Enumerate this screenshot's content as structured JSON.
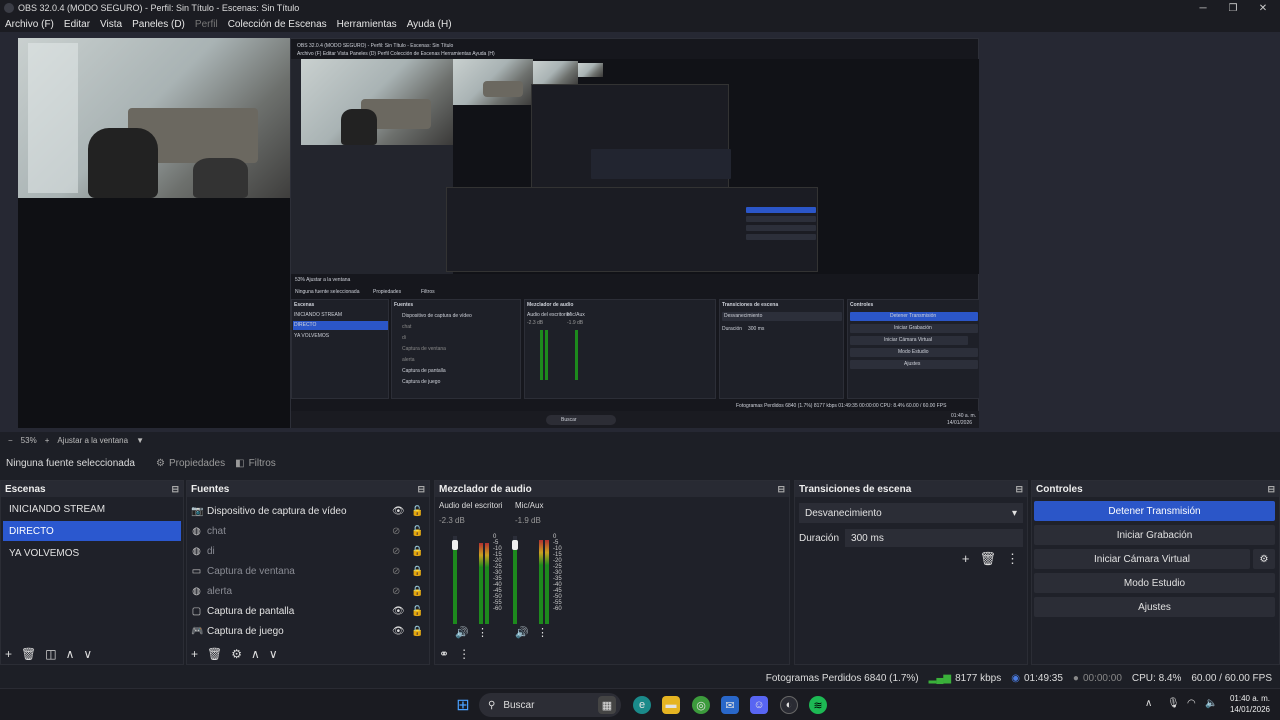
{
  "window": {
    "title": "OBS 32.0.4 (MODO SEGURO) - Perfil: Sin Título - Escenas: Sin Título",
    "minimize": "─",
    "maximize": "❐",
    "close": "✕"
  },
  "menu": [
    "Archivo (F)",
    "Editar",
    "Vista",
    "Paneles (D)",
    "Perfil",
    "Colección de Escenas",
    "Herramientas",
    "Ayuda (H)"
  ],
  "nested_preview": {
    "title": "OBS 32.0.4 (MODO SEGURO) - Perfil: Sin Título - Escenas: Sin Título",
    "menu": "Archivo (F)   Editar   Vista   Paneles (D)   Perfil   Colección de Escenas   Herramientas   Ayuda (H)",
    "zoom": "53%   Ajustar a la ventana",
    "no_source": "Ninguna fuente seleccionada",
    "props": "Propiedades",
    "filters": "Filtros",
    "docks": {
      "scenes": "Escenas",
      "sources": "Fuentes",
      "mixer": "Mezclador de audio",
      "transitions": "Transiciones de escena",
      "controls": "Controles"
    },
    "scenes": [
      "INICIANDO STREAM",
      "DIRECTO",
      "YA VOLVEMOS"
    ],
    "sources": [
      "Dispositivo de captura de vídeo",
      "chat",
      "di",
      "Captura de ventana",
      "alerta",
      "Captura de pantalla",
      "Captura de juego"
    ],
    "mixer_ch1": "Audio del escritorio",
    "mixer_ch2": "Mic/Aux",
    "mixer_db1": "-2.3 dB",
    "mixer_db2": "-1.9 dB",
    "transition": "Desvanecimiento",
    "duration_label": "Duración",
    "duration": "300 ms",
    "controls": [
      "Detener Transmisión",
      "Iniciar Grabación",
      "Iniciar Cámara Virtual",
      "Modo Estudio",
      "Ajustes"
    ],
    "status": "Fotogramas Perdidos 6840 (1.7%)   8177 kbps   01:49:35   00:00:00   CPU: 8.4%   60.00 / 60.00 FPS",
    "search": "Buscar",
    "time": "01:40 a. m.",
    "date": "14/01/2026"
  },
  "zoom": {
    "minus": "−",
    "level": "53%",
    "plus": "+",
    "fit": "Ajustar a la ventana",
    "arrow": "▼"
  },
  "properties_bar": {
    "no_source": "Ninguna fuente seleccionada",
    "properties": "Propiedades",
    "filters": "Filtros"
  },
  "scenes_dock": {
    "title": "Escenas",
    "items": [
      "INICIANDO STREAM",
      "DIRECTO",
      "YA VOLVEMOS"
    ],
    "selected_index": 1
  },
  "sources_dock": {
    "title": "Fuentes",
    "items": [
      {
        "label": "Dispositivo de captura de vídeo",
        "icon": "camera-icon",
        "visible": true,
        "locked": false
      },
      {
        "label": "chat",
        "icon": "globe-icon",
        "visible": false,
        "locked": false
      },
      {
        "label": "di",
        "icon": "globe-icon",
        "visible": false,
        "locked": true
      },
      {
        "label": "Captura de ventana",
        "icon": "window-icon",
        "visible": false,
        "locked": true
      },
      {
        "label": "alerta",
        "icon": "globe-icon",
        "visible": false,
        "locked": true
      },
      {
        "label": "Captura de pantalla",
        "icon": "monitor-icon",
        "visible": true,
        "locked": false
      },
      {
        "label": "Captura de juego",
        "icon": "gamepad-icon",
        "visible": true,
        "locked": true
      }
    ]
  },
  "mixer_dock": {
    "title": "Mezclador de audio",
    "channels": [
      {
        "name": "Audio del escritorio",
        "db": "-2.3 dB",
        "level": 0.92
      },
      {
        "name": "Mic/Aux",
        "db": "-1.9 dB",
        "level": 0.95
      }
    ],
    "ticks": [
      "0",
      "-5",
      "-10",
      "-15",
      "-20",
      "-25",
      "-30",
      "-35",
      "-40",
      "-45",
      "-50",
      "-55",
      "-60"
    ]
  },
  "transitions_dock": {
    "title": "Transiciones de escena",
    "selected": "Desvanecimiento",
    "duration_label": "Duración",
    "duration": "300 ms"
  },
  "controls_dock": {
    "title": "Controles",
    "buttons": [
      "Detener Transmisión",
      "Iniciar Grabación",
      "Iniciar Cámara Virtual",
      "Modo Estudio",
      "Ajustes"
    ]
  },
  "status": {
    "dropped": "Fotogramas Perdidos 6840 (1.7%)",
    "bitrate": "8177 kbps",
    "stream_time": "01:49:35",
    "rec_time": "00:00:00",
    "cpu": "CPU: 8.4%",
    "fps": "60.00 / 60.00 FPS"
  },
  "taskbar": {
    "search": "Buscar",
    "time": "01:40 a. m.",
    "date": "14/01/2026"
  },
  "colors": {
    "accent": "#2b56c8",
    "bg": "#1d1f26",
    "panel": "#1f2129"
  }
}
